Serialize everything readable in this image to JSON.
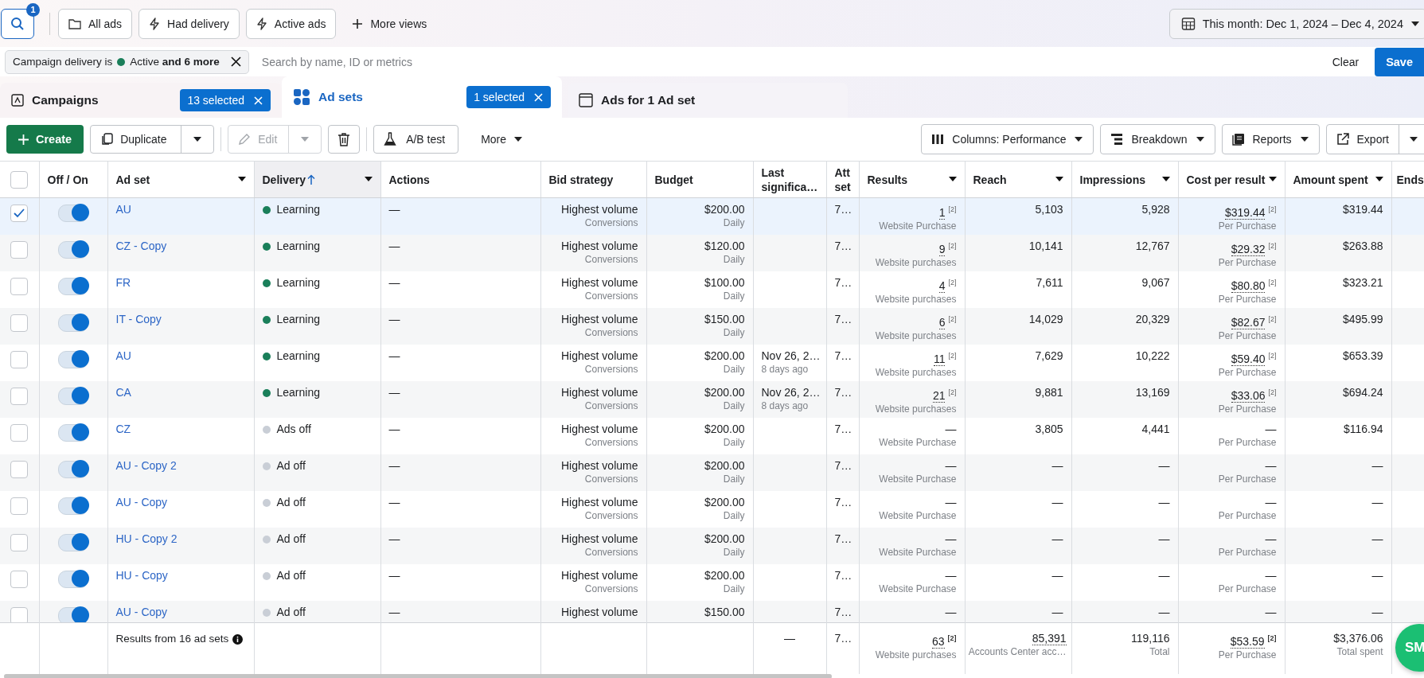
{
  "top_bar": {
    "search_badge": "1",
    "views": [
      {
        "label": "All ads",
        "kind": "folder"
      },
      {
        "label": "Had delivery",
        "kind": "bolt"
      },
      {
        "label": "Active ads",
        "kind": "bolt"
      }
    ],
    "more_views": "More views",
    "date_range": "This month: Dec 1, 2024 – Dec 4, 2024"
  },
  "filter_bar": {
    "chip": {
      "prefix": "Campaign delivery is",
      "color": "#1a7f5a",
      "value": "Active **and 6 more**"
    },
    "search": {
      "placeholder": "Search by name, ID or metrics"
    },
    "clear": "Clear",
    "save": "Save"
  },
  "tabs": [
    {
      "label": "Campaigns",
      "kind": "campaign",
      "badge": "13 selected",
      "selected": false
    },
    {
      "label": "Ad sets",
      "kind": "grid",
      "badge": "1 selected",
      "selected": true
    },
    {
      "label": "Ads for 1 Ad set",
      "kind": "window",
      "selected": false
    }
  ],
  "toolbar": {
    "left": [
      {
        "label": "Create",
        "kind": "create"
      },
      {
        "label": "Duplicate",
        "kind": "duplicate",
        "disabled": false
      },
      {
        "label": "Edit",
        "kind": "edit",
        "disabled": true
      },
      {
        "kind": "trash"
      },
      {
        "label": "A/B test",
        "kind": "flask"
      },
      {
        "label": "More",
        "kind": "menu"
      }
    ],
    "right": [
      {
        "label": "Columns: Performance",
        "kind": "columns",
        "split": false
      },
      {
        "label": "Breakdown",
        "kind": "breakdown",
        "split": false
      },
      {
        "label": "Reports",
        "kind": "reports",
        "split": false
      },
      {
        "label": "Export",
        "kind": "export",
        "split": true
      }
    ]
  },
  "table": {
    "all_checked": false,
    "columns": [
      {
        "label": "Off / On",
        "sortable": false,
        "sorted": false
      },
      {
        "label": "Ad set",
        "sortable": true,
        "sorted": false
      },
      {
        "label": "Delivery",
        "sortable": true,
        "sorted": true
      },
      {
        "label": "Actions",
        "sortable": false,
        "sorted": false
      },
      {
        "label": "Bid strategy",
        "sortable": false,
        "sorted": false
      },
      {
        "label": "Budget",
        "sortable": false,
        "sorted": false
      },
      {
        "label": "Last significa…",
        "sortable": false,
        "sorted": false
      },
      {
        "label": "Att set",
        "sortable": false,
        "sorted": false
      },
      {
        "label": "Results",
        "sortable": true,
        "sorted": false
      },
      {
        "label": "Reach",
        "sortable": true,
        "sorted": false
      },
      {
        "label": "Impressions",
        "sortable": true,
        "sorted": false
      },
      {
        "label": "Cost per result",
        "sortable": true,
        "sorted": false
      },
      {
        "label": "Amount spent",
        "sortable": true,
        "sorted": false
      },
      {
        "label": "Ends",
        "sortable": false,
        "sorted": false
      }
    ],
    "rows": [
      {
        "selected": true,
        "on": true,
        "name": "AU",
        "delivery": "Learning",
        "color": "#1a7f5a",
        "actions": "—",
        "bid": "Highest volume",
        "bid_sub": "Conversions",
        "budget": "$200.00",
        "budget_sub": "Daily",
        "att": "7…",
        "results": "1",
        "results_note": "[2]",
        "results_sub": "Website Purchase",
        "reach": "5,103",
        "impressions": "5,928",
        "cost": "$319.44",
        "cost_note": "[2]",
        "cost_sub": "Per Purchase",
        "spent": "$319.44"
      },
      {
        "selected": false,
        "on": true,
        "name": "CZ - Copy",
        "delivery": "Learning",
        "color": "#1a7f5a",
        "actions": "—",
        "bid": "Highest volume",
        "bid_sub": "Conversions",
        "budget": "$120.00",
        "budget_sub": "Daily",
        "att": "7…",
        "results": "9",
        "results_note": "[2]",
        "results_sub": "Website purchases",
        "reach": "10,141",
        "impressions": "12,767",
        "cost": "$29.32",
        "cost_note": "[2]",
        "cost_sub": "Per Purchase",
        "spent": "$263.88"
      },
      {
        "selected": false,
        "on": true,
        "name": "FR",
        "delivery": "Learning",
        "color": "#1a7f5a",
        "actions": "—",
        "bid": "Highest volume",
        "bid_sub": "Conversions",
        "budget": "$100.00",
        "budget_sub": "Daily",
        "att": "7…",
        "results": "4",
        "results_note": "[2]",
        "results_sub": "Website purchases",
        "reach": "7,611",
        "impressions": "9,067",
        "cost": "$80.80",
        "cost_note": "[2]",
        "cost_sub": "Per Purchase",
        "spent": "$323.21"
      },
      {
        "selected": false,
        "on": true,
        "name": "IT - Copy",
        "delivery": "Learning",
        "color": "#1a7f5a",
        "actions": "—",
        "bid": "Highest volume",
        "bid_sub": "Conversions",
        "budget": "$150.00",
        "budget_sub": "Daily",
        "att": "7…",
        "results": "6",
        "results_note": "[2]",
        "results_sub": "Website purchases",
        "reach": "14,029",
        "impressions": "20,329",
        "cost": "$82.67",
        "cost_note": "[2]",
        "cost_sub": "Per Purchase",
        "spent": "$495.99"
      },
      {
        "selected": false,
        "on": true,
        "name": "AU",
        "delivery": "Learning",
        "color": "#1a7f5a",
        "actions": "—",
        "bid": "Highest volume",
        "bid_sub": "Conversions",
        "budget": "$200.00",
        "budget_sub": "Daily",
        "last": "Nov 26, 2…",
        "last_sub": "8 days ago",
        "att": "7…",
        "results": "11",
        "results_note": "[2]",
        "results_sub": "Website purchases",
        "reach": "7,629",
        "impressions": "10,222",
        "cost": "$59.40",
        "cost_note": "[2]",
        "cost_sub": "Per Purchase",
        "spent": "$653.39"
      },
      {
        "selected": false,
        "on": true,
        "name": "CA",
        "delivery": "Learning",
        "color": "#1a7f5a",
        "actions": "—",
        "bid": "Highest volume",
        "bid_sub": "Conversions",
        "budget": "$200.00",
        "budget_sub": "Daily",
        "last": "Nov 26, 2…",
        "last_sub": "8 days ago",
        "att": "7…",
        "results": "21",
        "results_note": "[2]",
        "results_sub": "Website purchases",
        "reach": "9,881",
        "impressions": "13,169",
        "cost": "$33.06",
        "cost_note": "[2]",
        "cost_sub": "Per Purchase",
        "spent": "$694.24"
      },
      {
        "selected": false,
        "on": true,
        "name": "CZ",
        "delivery": "Ads off",
        "color": "#c9ced6",
        "actions": "—",
        "bid": "Highest volume",
        "bid_sub": "Conversions",
        "budget": "$200.00",
        "budget_sub": "Daily",
        "att": "7…",
        "results": "—",
        "results_sub": "Website Purchase",
        "reach": "3,805",
        "impressions": "4,441",
        "cost": "—",
        "cost_sub": "Per Purchase",
        "spent": "$116.94"
      },
      {
        "selected": false,
        "on": true,
        "name": "AU - Copy 2",
        "delivery": "Ad off",
        "color": "#c9ced6",
        "actions": "—",
        "bid": "Highest volume",
        "bid_sub": "Conversions",
        "budget": "$200.00",
        "budget_sub": "Daily",
        "att": "7…",
        "results": "—",
        "results_sub": "Website Purchase",
        "reach": "—",
        "impressions": "—",
        "cost": "—",
        "cost_sub": "Per Purchase",
        "spent": "—"
      },
      {
        "selected": false,
        "on": true,
        "name": "AU - Copy",
        "delivery": "Ad off",
        "color": "#c9ced6",
        "actions": "—",
        "bid": "Highest volume",
        "bid_sub": "Conversions",
        "budget": "$200.00",
        "budget_sub": "Daily",
        "att": "7…",
        "results": "—",
        "results_sub": "Website Purchase",
        "reach": "—",
        "impressions": "—",
        "cost": "—",
        "cost_sub": "Per Purchase",
        "spent": "—"
      },
      {
        "selected": false,
        "on": true,
        "name": "HU - Copy 2",
        "delivery": "Ad off",
        "color": "#c9ced6",
        "actions": "—",
        "bid": "Highest volume",
        "bid_sub": "Conversions",
        "budget": "$200.00",
        "budget_sub": "Daily",
        "att": "7…",
        "results": "—",
        "results_sub": "Website Purchase",
        "reach": "—",
        "impressions": "—",
        "cost": "—",
        "cost_sub": "Per Purchase",
        "spent": "—"
      },
      {
        "selected": false,
        "on": true,
        "name": "HU - Copy",
        "delivery": "Ad off",
        "color": "#c9ced6",
        "actions": "—",
        "bid": "Highest volume",
        "bid_sub": "Conversions",
        "budget": "$200.00",
        "budget_sub": "Daily",
        "att": "7…",
        "results": "—",
        "results_sub": "Website Purchase",
        "reach": "—",
        "impressions": "—",
        "cost": "—",
        "cost_sub": "Per Purchase",
        "spent": "—"
      },
      {
        "selected": false,
        "on": true,
        "name": "AU - Copy",
        "delivery": "Ad off",
        "color": "#c9ced6",
        "actions": "—",
        "bid": "Highest volume",
        "budget": "$150.00",
        "att": "7…",
        "results": "—",
        "reach": "—",
        "impressions": "—",
        "cost": "—",
        "spent": "—"
      }
    ],
    "footer": {
      "label": "Results from 16 ad sets",
      "last": "—",
      "att": "7…",
      "results": "63",
      "results_note": "[2]",
      "results_sub": "Website purchases",
      "reach": "85,391",
      "reach_sub": "Accounts Center acc…",
      "impressions": "119,116",
      "impressions_sub": "Total",
      "cost": "$53.59",
      "cost_note": "[2]",
      "cost_sub": "Per Purchase",
      "spent": "$3,376.06",
      "spent_sub": "Total spent"
    }
  },
  "help_button": "SM"
}
